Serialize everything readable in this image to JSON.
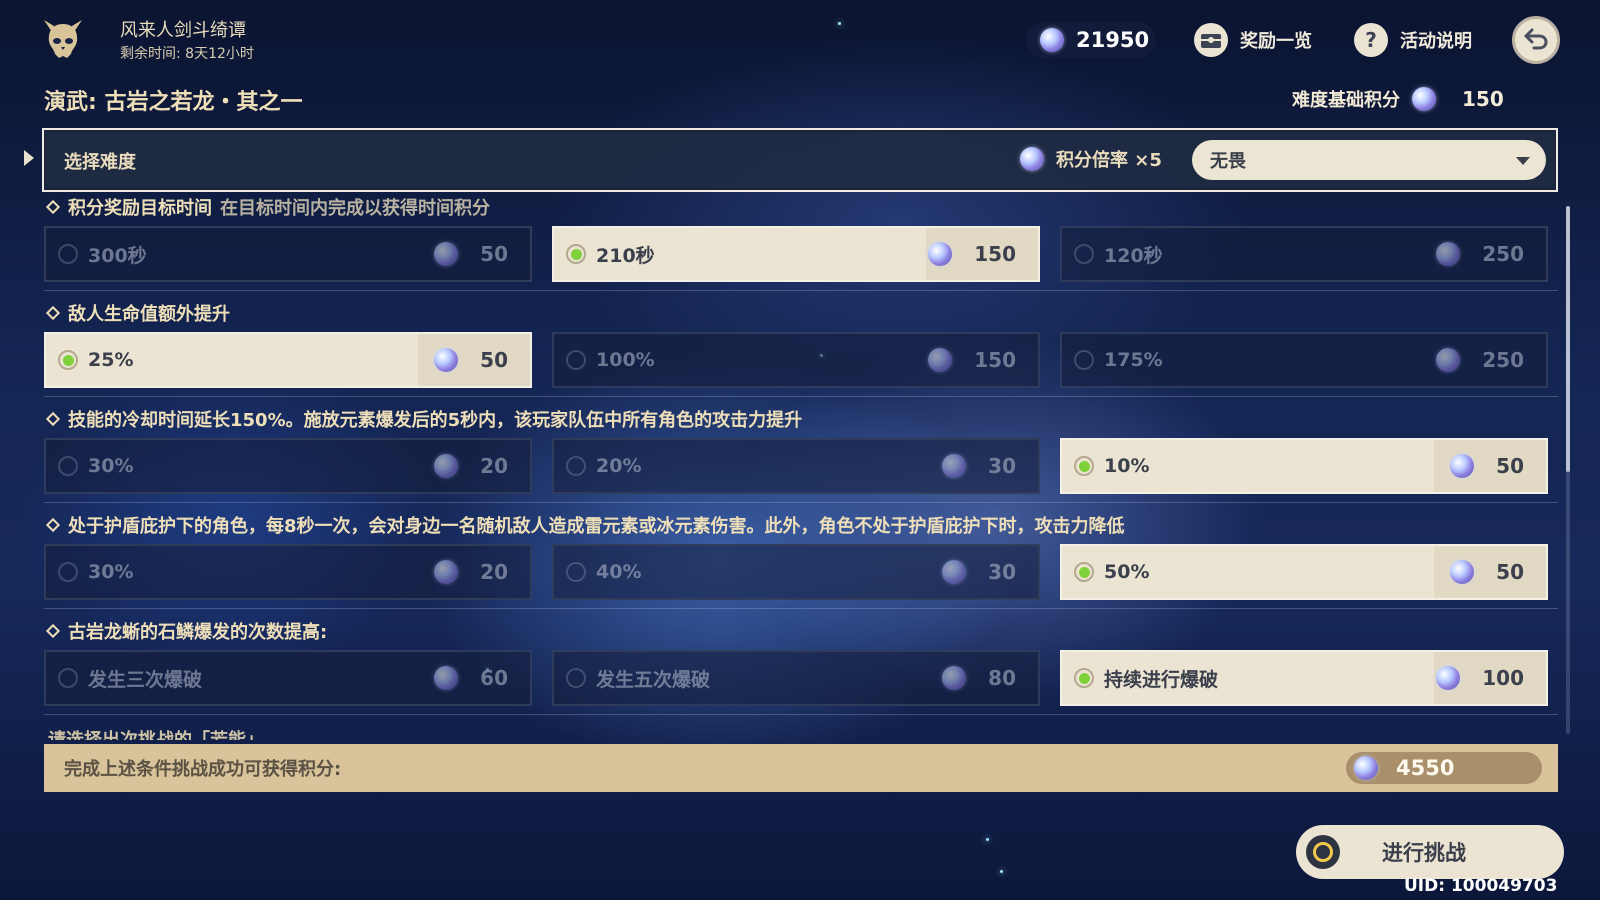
{
  "event": {
    "title": "风来人剑斗绮谭",
    "time_left": "剩余时间: 8天12小时"
  },
  "header": {
    "currency_value": "21950",
    "rewards_label": "奖励一览",
    "help_label": "活动说明"
  },
  "trial": {
    "title": "演武: 古岩之若龙・其之一",
    "base_score_label": "难度基础积分",
    "base_score_value": "150"
  },
  "difficulty": {
    "label": "选择难度",
    "multiplier": "积分倍率 ×5",
    "selected": "无畏"
  },
  "sections": [
    {
      "title": "积分奖励目标时间",
      "subtitle": "在目标时间内完成以获得时间积分",
      "options": [
        {
          "name": "300秒",
          "points": "50",
          "selected": false
        },
        {
          "name": "210秒",
          "points": "150",
          "selected": true
        },
        {
          "name": "120秒",
          "points": "250",
          "selected": false
        }
      ]
    },
    {
      "title": "敌人生命值额外提升",
      "subtitle": "",
      "options": [
        {
          "name": "25%",
          "points": "50",
          "selected": true
        },
        {
          "name": "100%",
          "points": "150",
          "selected": false
        },
        {
          "name": "175%",
          "points": "250",
          "selected": false
        }
      ]
    },
    {
      "title": "技能的冷却时间延长150%。施放元素爆发后的5秒内，该玩家队伍中所有角色的攻击力提升",
      "subtitle": "",
      "options": [
        {
          "name": "30%",
          "points": "20",
          "selected": false
        },
        {
          "name": "20%",
          "points": "30",
          "selected": false
        },
        {
          "name": "10%",
          "points": "50",
          "selected": true
        }
      ]
    },
    {
      "title": "处于护盾庇护下的角色，每8秒一次，会对身边一名随机敌人造成雷元素或冰元素伤害。此外，角色不处于护盾庇护下时，攻击力降低",
      "subtitle": "",
      "options": [
        {
          "name": "30%",
          "points": "20",
          "selected": false
        },
        {
          "name": "40%",
          "points": "30",
          "selected": false
        },
        {
          "name": "50%",
          "points": "50",
          "selected": true
        }
      ]
    },
    {
      "title": "古岩龙蜥的石鳞爆发的次数提高:",
      "subtitle": "",
      "options": [
        {
          "name": "发生三次爆破",
          "points": "60",
          "selected": false
        },
        {
          "name": "发生五次爆破",
          "points": "80",
          "selected": false
        },
        {
          "name": "持续进行爆破",
          "points": "100",
          "selected": true
        }
      ]
    }
  ],
  "cut_text": "请选择出次挑战的「芳能」",
  "total": {
    "label": "完成上述条件挑战成功可获得积分:",
    "value": "4550"
  },
  "challenge_button": "进行挑战",
  "uid": "UID: 100049703",
  "colors": {
    "selected_radio": "#7fd13a",
    "panel_light": "#ebe4d3",
    "total_bar": "#d8c39a"
  }
}
